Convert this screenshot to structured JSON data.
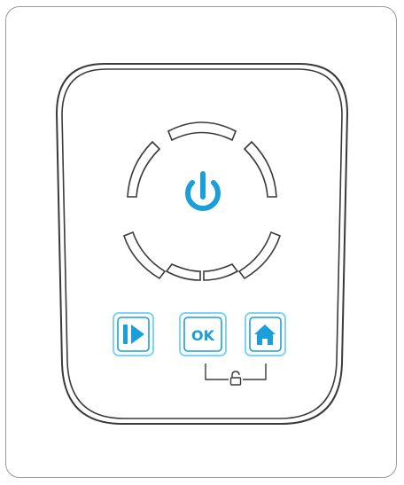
{
  "device": {
    "buttons": {
      "play": {
        "icon": "play-step-icon"
      },
      "ok": {
        "label": "OK"
      },
      "home": {
        "icon": "home-icon"
      }
    },
    "power": {
      "icon": "power-icon"
    },
    "lock": {
      "icon": "lock-icon"
    }
  },
  "colors": {
    "accent": "#1a9fd9",
    "outline": "#3a3a3a",
    "frame": "#9a9a9a",
    "button_glow": "#7fd3f5"
  }
}
